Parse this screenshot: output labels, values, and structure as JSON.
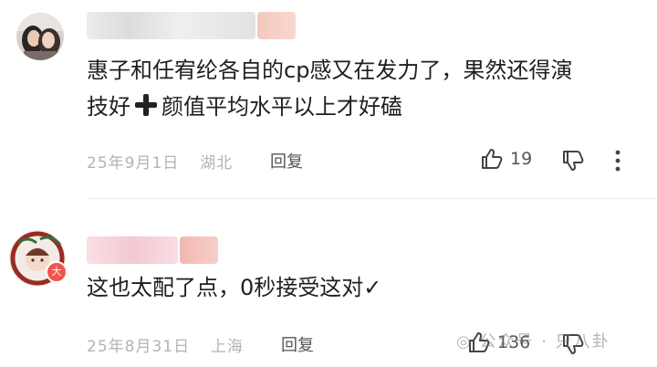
{
  "comments": [
    {
      "content_line1": "惠子和任宥纶各自的cp感又在发力了，果然还得演",
      "content_line2_a": "技好",
      "content_line2_b": "颜值平均水平以上才好磕",
      "date": "25年9月1日",
      "location": "湖北",
      "reply_label": "回复",
      "likes": "19"
    },
    {
      "content": "这也太配了点，0秒接受这对✓",
      "date": "25年8月31日",
      "location": "上海",
      "reply_label": "回复",
      "likes": "136",
      "badge": "大"
    }
  ],
  "watermark": "公众号 · 只八卦",
  "colors": {
    "name_blur_gray": "#e6e6e6",
    "name_blur_pink": "#f6cdc6",
    "badge": "#f1554e"
  }
}
